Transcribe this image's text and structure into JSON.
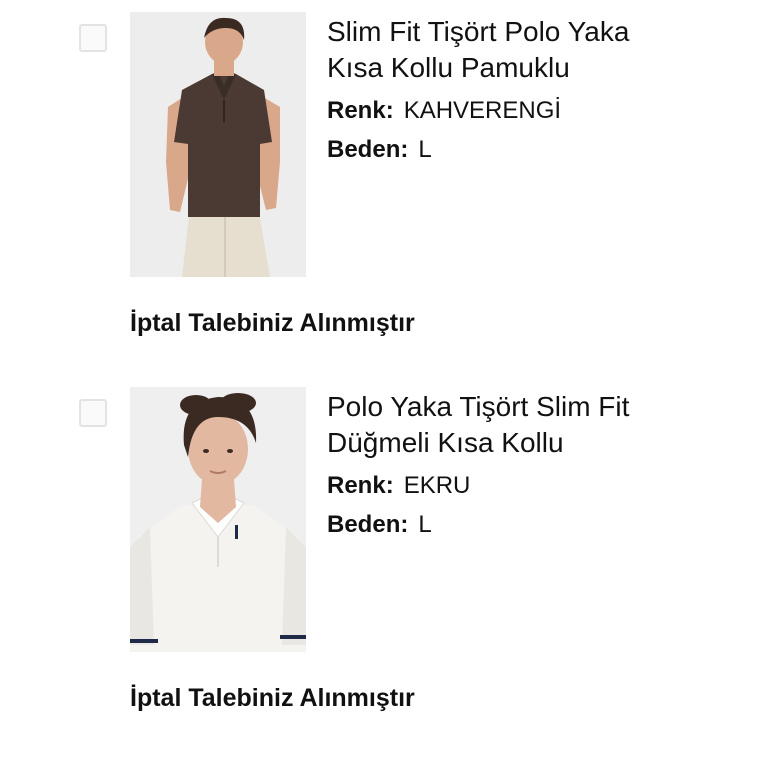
{
  "orders": [
    {
      "title_line1": "Slim Fit Tişört Polo Yaka",
      "title_line2": "Kısa Kollu Pamuklu",
      "color_label": "Renk:",
      "color_value": "KAHVERENGİ",
      "size_label": "Beden:",
      "size_value": "L",
      "status": "İptal Talebiniz Alınmıştır",
      "checked": false,
      "colors": {
        "shirt": "#4a3a33",
        "pants": "#e6dfd0",
        "skin": "#d9a88a",
        "bg": "#ededed"
      }
    },
    {
      "title_line1": "Polo Yaka Tişört Slim Fit",
      "title_line2": "Düğmeli Kısa Kollu",
      "color_label": "Renk:",
      "color_value": "EKRU",
      "size_label": "Beden:",
      "size_value": "L",
      "status": "İptal Talebiniz Alınmıştır",
      "checked": false,
      "colors": {
        "shirt": "#f4f3ef",
        "skin": "#e2b8a0",
        "hair": "#3a2a22",
        "bg": "#efefef"
      }
    }
  ]
}
